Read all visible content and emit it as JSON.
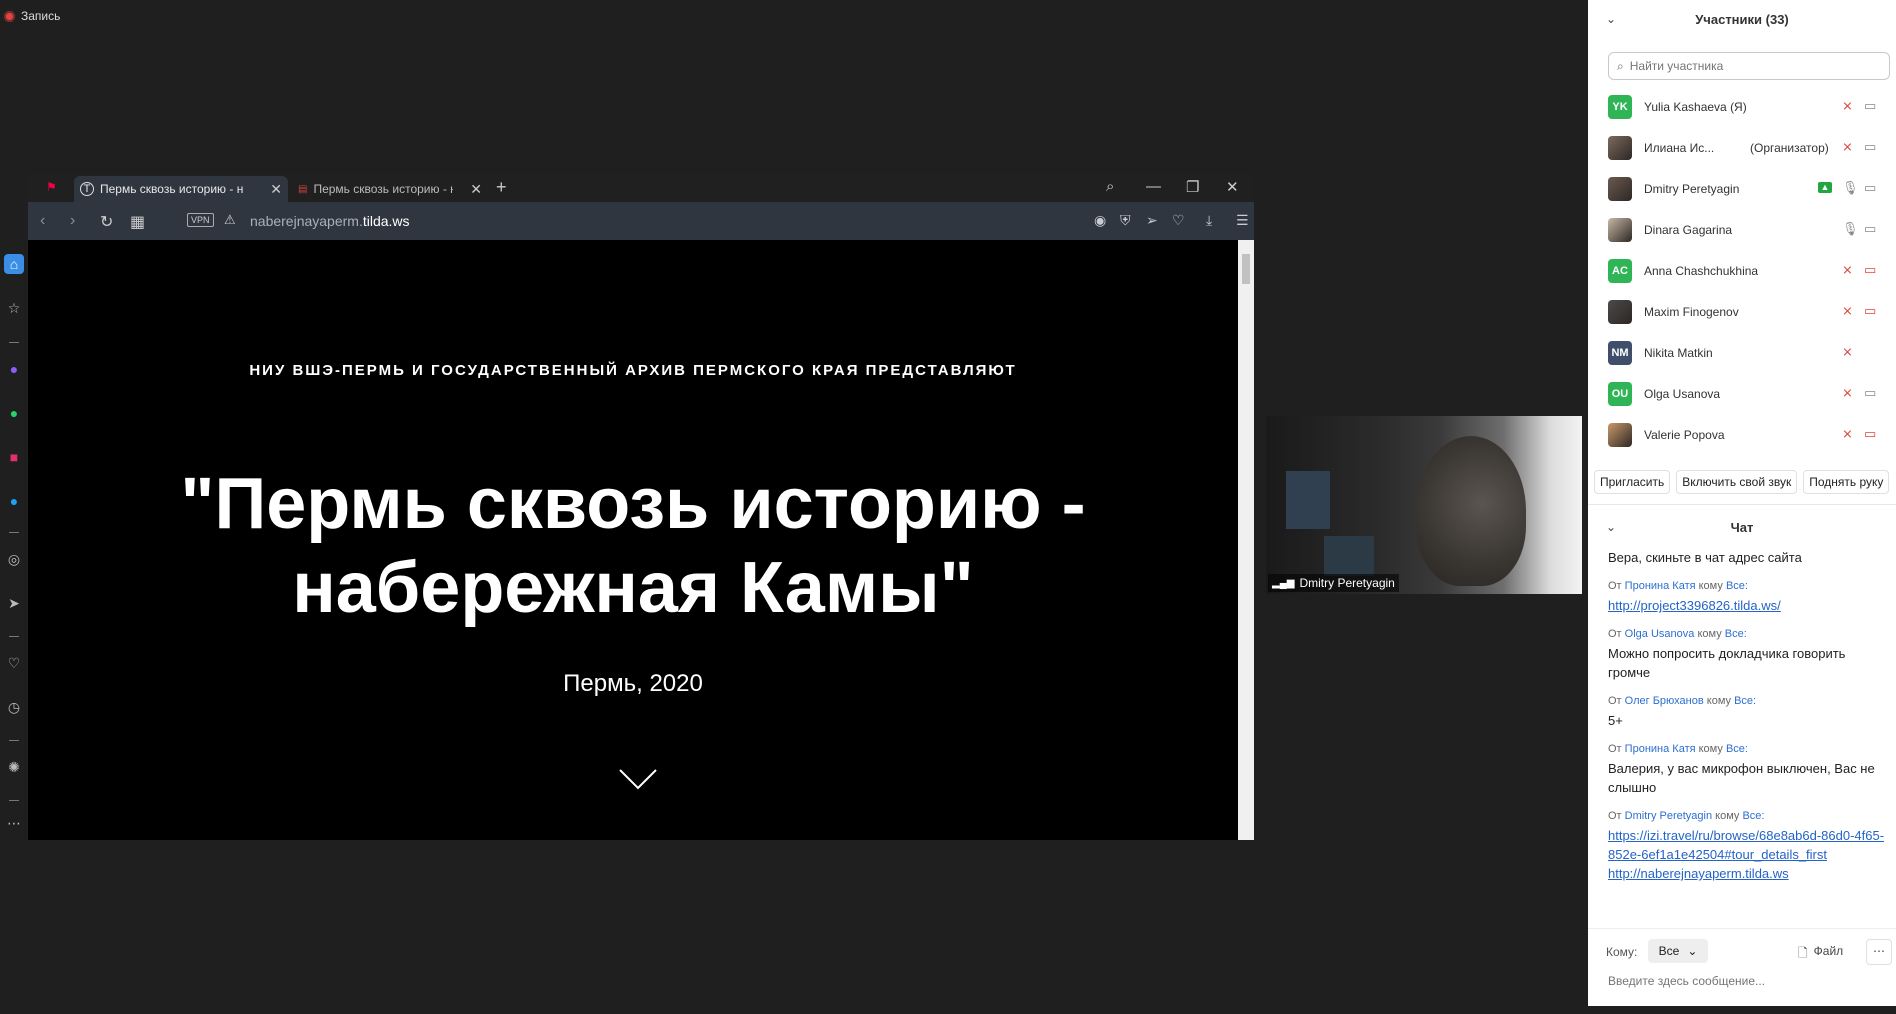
{
  "recording": {
    "label": "Запись"
  },
  "browser": {
    "tabs": [
      {
        "title": "Пермь сквозь историю - н",
        "active": true
      },
      {
        "title": "Пермь сквозь историю - н",
        "active": false
      }
    ],
    "address": {
      "vpn": "VPN",
      "url_prefix": "naberejnayaperm.",
      "url_domain": "tilda.ws"
    }
  },
  "page": {
    "subtitle": "НИУ ВШЭ-ПЕРМЬ И ГОСУДАРСТВЕННЫЙ АРХИВ ПЕРМСКОГО КРАЯ ПРЕДСТАВЛЯЮТ",
    "title_line1": "\"Пермь сквозь историю -",
    "title_line2": "набережная Камы\"",
    "place_year": "Пермь, 2020"
  },
  "video": {
    "name": "Dmitry Peretyagin"
  },
  "participants_panel": {
    "title": "Участники (33)",
    "search_placeholder": "Найти участника",
    "participants": [
      {
        "initials": "YK",
        "name": "Yulia Kashaeva (Я)",
        "extra": "",
        "avatar_color": "#2fb555",
        "photo": false,
        "mic": "muted",
        "cam": "on",
        "share": false
      },
      {
        "initials": "",
        "name": "Илиана Ис...",
        "extra": "(Организатор)",
        "avatar_color": "#7d6a5e",
        "photo": true,
        "mic": "muted",
        "cam": "on",
        "share": false
      },
      {
        "initials": "",
        "name": "Dmitry Peretyagin",
        "extra": "",
        "avatar_color": "#6b5a50",
        "photo": true,
        "mic": "on",
        "cam": "on",
        "share": true
      },
      {
        "initials": "",
        "name": "Dinara Gagarina",
        "extra": "",
        "avatar_color": "#c8b8a6",
        "photo": true,
        "mic": "on",
        "cam": "on",
        "share": false
      },
      {
        "initials": "AC",
        "name": "Anna Chashchukhina",
        "extra": "",
        "avatar_color": "#2fb555",
        "photo": false,
        "mic": "muted",
        "cam": "muted",
        "share": false
      },
      {
        "initials": "",
        "name": "Maxim Finogenov",
        "extra": "",
        "avatar_color": "#4a4a4a",
        "photo": true,
        "mic": "muted",
        "cam": "muted",
        "share": false
      },
      {
        "initials": "NM",
        "name": "Nikita Matkin",
        "extra": "",
        "avatar_color": "#3f4f6b",
        "photo": false,
        "mic": "muted",
        "cam": "none",
        "share": false
      },
      {
        "initials": "OU",
        "name": "Olga Usanova",
        "extra": "",
        "avatar_color": "#2fb555",
        "photo": false,
        "mic": "muted",
        "cam": "on",
        "share": false
      },
      {
        "initials": "",
        "name": "Valerie Popova",
        "extra": "",
        "avatar_color": "#c89a6a",
        "photo": true,
        "mic": "muted",
        "cam": "muted",
        "share": false
      }
    ],
    "actions": [
      "Пригласить",
      "Включить свой звук",
      "Поднять руку"
    ]
  },
  "chat": {
    "title": "Чат",
    "messages": [
      {
        "from": "",
        "to": "",
        "text": "Вера, скиньте в чат адрес сайта"
      },
      {
        "from": "Пронина Катя",
        "to": "Все:",
        "link": "http://project3396826.tilda.ws/"
      },
      {
        "from": "Olga Usanova",
        "to": "Все:",
        "text": "Можно попросить докладчика говорить громче"
      },
      {
        "from": "Олег Брюханов",
        "to": "Все:",
        "text": "5+"
      },
      {
        "from": "Пронина Катя",
        "to": "Все:",
        "text": "Валерия, у вас микрофон выключен, Вас не слышно"
      },
      {
        "from": "Dmitry Peretyagin",
        "to": "Все:",
        "link": "https://izi.travel/ru/browse/68e8ab6d-86d0-4f65-852e-6ef1a1e42504#tour_details_first",
        "link2": "http://naberejnayaperm.tilda.ws"
      }
    ],
    "meta_from": "От",
    "meta_to": "кому",
    "to_label": "Кому:",
    "to_value": "Все",
    "file_label": "Файл",
    "input_placeholder": "Введите здесь сообщение..."
  }
}
